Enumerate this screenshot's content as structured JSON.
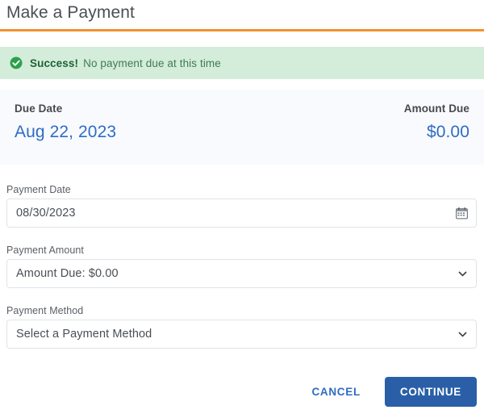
{
  "header": {
    "title": "Make a Payment",
    "rule_color": "#f4912e"
  },
  "alert": {
    "icon": "check-circle-icon",
    "strong": "Success!",
    "message": "No payment due at this time",
    "background": "#d4edda",
    "strong_color": "#1d6234",
    "text_color": "#3c7c52"
  },
  "summary": {
    "due_date_label": "Due Date",
    "due_date_value": "Aug 22, 2023",
    "amount_due_label": "Amount Due",
    "amount_due_value": "$0.00",
    "value_color": "#2f6cc4",
    "panel_background": "#f8fafd"
  },
  "form": {
    "payment_date": {
      "label": "Payment Date",
      "value": "08/30/2023",
      "icon": "calendar-icon"
    },
    "payment_amount": {
      "label": "Payment Amount",
      "value": "Amount Due: $0.00",
      "icon": "chevron-down-icon"
    },
    "payment_method": {
      "label": "Payment Method",
      "value": "Select a Payment Method",
      "icon": "chevron-down-icon"
    }
  },
  "actions": {
    "cancel_label": "CANCEL",
    "continue_label": "CONTINUE",
    "cancel_color": "#2f6cc4",
    "continue_background": "#2a5fa8"
  }
}
